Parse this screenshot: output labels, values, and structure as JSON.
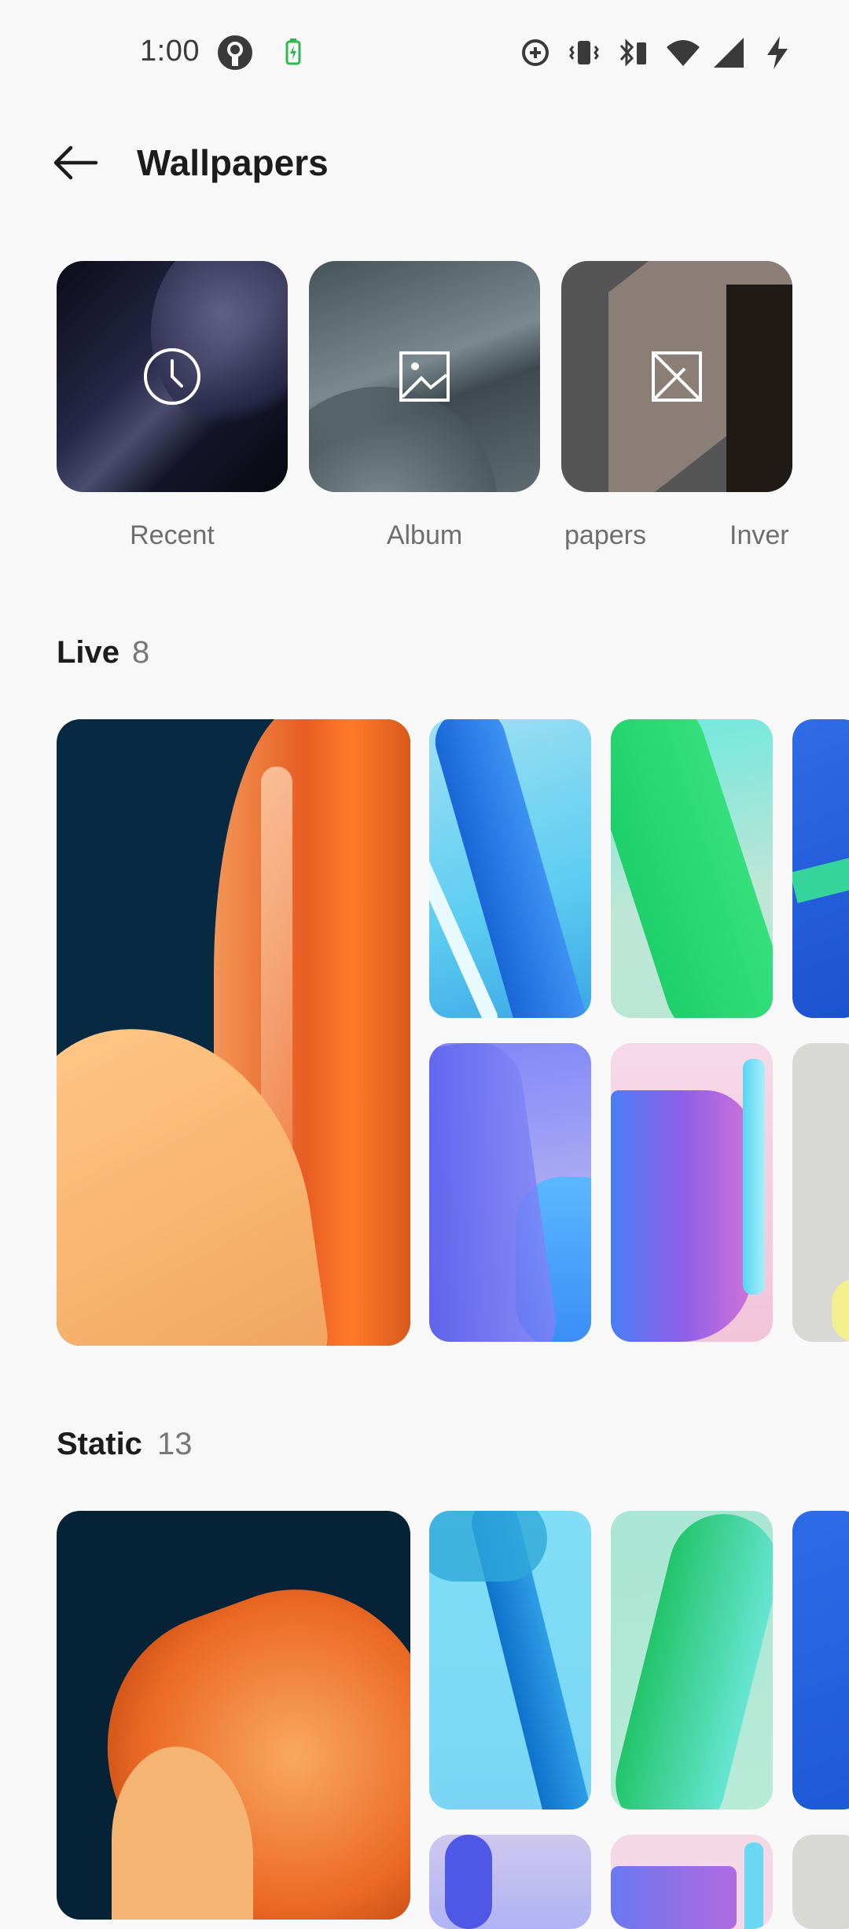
{
  "status_bar": {
    "time": "1:00",
    "icons": [
      "vpn-key-icon",
      "battery-saver-icon",
      "data-saver-icon",
      "vibrate-icon",
      "bluetooth-battery-icon",
      "wifi-icon",
      "signal-icon",
      "charging-icon"
    ]
  },
  "header": {
    "title": "Wallpapers",
    "back_icon": "arrow-left-icon"
  },
  "categories": [
    {
      "label": "Recent",
      "icon": "clock-icon"
    },
    {
      "label": "Album",
      "icon": "image-icon"
    },
    {
      "label": "papers",
      "icon": "wallpaper-icon"
    },
    {
      "label": "Inver",
      "icon": ""
    }
  ],
  "sections": {
    "live": {
      "title": "Live",
      "count": "8"
    },
    "static": {
      "title": "Static",
      "count": "13"
    }
  },
  "colors": {
    "background": "#f8f8f8",
    "text": "#1c1c1c",
    "secondary_text": "#777777"
  }
}
